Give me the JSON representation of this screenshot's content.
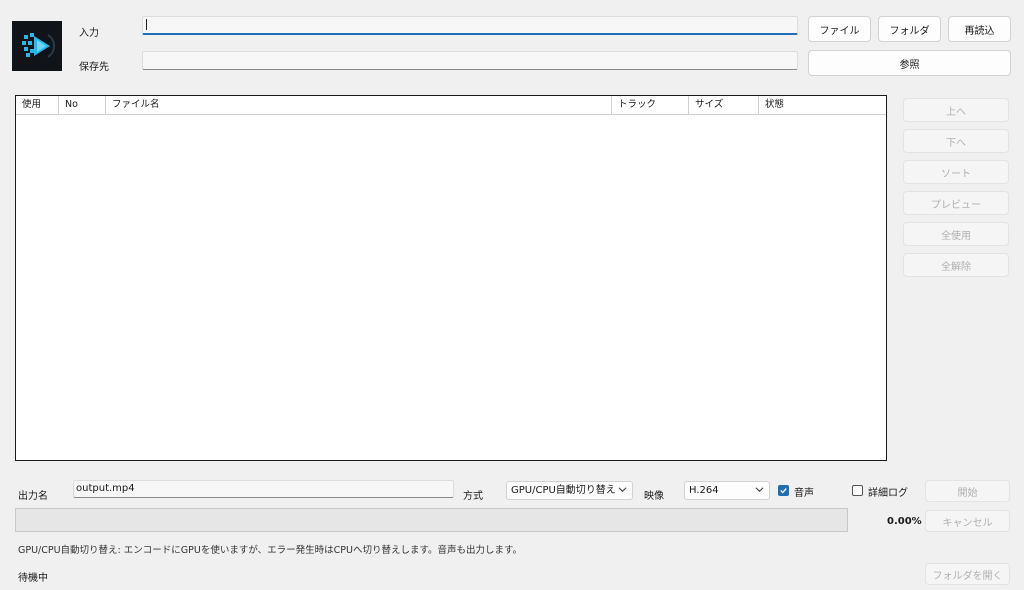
{
  "top": {
    "input_label": "入力",
    "input_value": "",
    "output_label": "保存先",
    "output_value": "",
    "file_button": "ファイル",
    "folder_button": "フォルダ",
    "reload_button": "再読込",
    "browse_button": "参照"
  },
  "table": {
    "columns": [
      "使用",
      "No",
      "ファイル名",
      "トラック",
      "サイズ",
      "状態"
    ]
  },
  "side_buttons": [
    "上へ",
    "下へ",
    "ソート",
    "プレビュー",
    "全使用",
    "全解除"
  ],
  "bottom": {
    "output_name_label": "出力名",
    "output_name_value": "output.mp4",
    "method_label": "方式",
    "method_value": "GPU/CPU自動切り替え",
    "video_label": "映像",
    "video_value": "H.264",
    "audio_label": "音声",
    "audio_checked": true,
    "detail_log_label": "詳細ログ",
    "detail_log_checked": false,
    "start_button": "開始",
    "cancel_button": "キャンセル",
    "progress_percent": "0.00%",
    "progress_value": 0,
    "hint": "GPU/CPU自動切り替え: エンコードにGPUを使いますが、エラー発生時はCPUへ切り替えします。音声も出力します。",
    "status": "待機中",
    "open_folder_button": "フォルダを開く"
  },
  "colors": {
    "accent": "#1f6fb5",
    "window_bg": "#f0f0f0",
    "logo_bg": "#101418",
    "logo_cyan": "#29b6e8"
  }
}
